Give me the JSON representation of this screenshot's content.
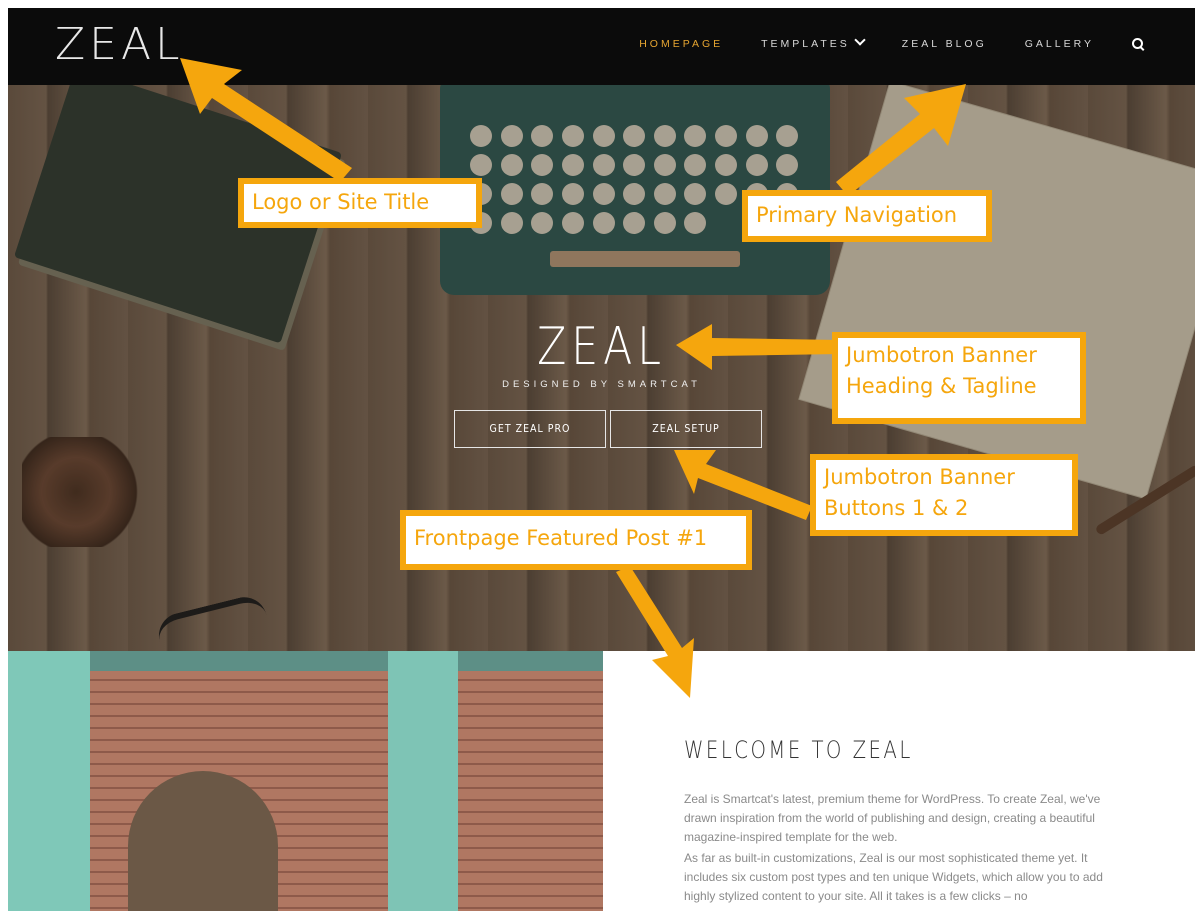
{
  "header": {
    "logo": "ZEAL",
    "nav": [
      {
        "label": "HOMEPAGE",
        "active": true
      },
      {
        "label": "TEMPLATES",
        "dropdown": true
      },
      {
        "label": "ZEAL BLOG"
      },
      {
        "label": "GALLERY"
      }
    ],
    "search_icon": "search-icon"
  },
  "hero": {
    "title": "ZEAL",
    "tagline": "DESIGNED BY SMARTCAT",
    "button1": "GET ZEAL PRO",
    "button2": "ZEAL SETUP"
  },
  "featured_post": {
    "title": "WELCOME TO ZEAL",
    "paragraphs": [
      "Zeal is Smartcat's latest, premium theme for WordPress. To create Zeal, we've drawn inspiration from the world of publishing and design, creating a beautiful magazine-inspired template for the web.",
      "As far as built-in customizations, Zeal is our most sophisticated theme yet. It includes six custom post types and ten unique Widgets, which allow you to add highly stylized content to your site. All it takes is a few clicks – no"
    ]
  },
  "annotations": {
    "logo": "Logo or Site Title",
    "nav": "Primary Navigation",
    "heading": "Jumbotron Banner Heading & Tagline",
    "buttons": "Jumbotron Banner Buttons 1 & 2",
    "featured": "Frontpage Featured Post #1"
  },
  "colors": {
    "accent": "#e6a531",
    "annotation": "#f5a60d",
    "navbar": "#0b0b0b"
  }
}
